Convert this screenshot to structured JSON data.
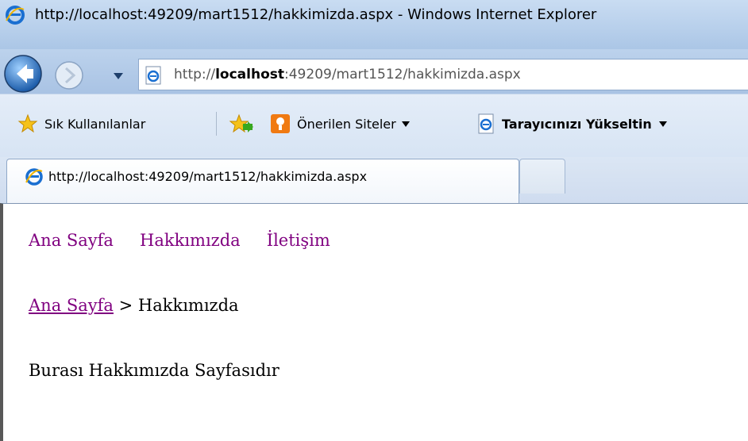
{
  "window": {
    "title": "http://localhost:49209/mart1512/hakkimizda.aspx - Windows Internet Explorer"
  },
  "address": {
    "prefix": "http://",
    "host": "localhost",
    "rest": ":49209/mart1512/hakkimizda.aspx"
  },
  "favorites": {
    "label": "Sık Kullanılanlar",
    "suggested": "Önerilen Siteler",
    "upgrade": "Tarayıcınızı Yükseltin"
  },
  "tab": {
    "label": "http://localhost:49209/mart1512/hakkimizda.aspx"
  },
  "page": {
    "menu": [
      "Ana Sayfa",
      "Hakkımızda",
      "İletişim"
    ],
    "breadcrumb": {
      "home": "Ana Sayfa",
      "separator": " > ",
      "current": "Hakkımızda"
    },
    "body_text": "Burası Hakkımızda Sayfasıdır"
  },
  "colors": {
    "link": "#800080",
    "chrome": "#b7cfeb"
  },
  "icons": [
    "ie-logo-icon",
    "back-arrow-icon",
    "forward-arrow-icon",
    "dropdown-chevron-icon",
    "page-icon",
    "star-icon",
    "add-favorites-icon",
    "suggested-sites-icon"
  ]
}
